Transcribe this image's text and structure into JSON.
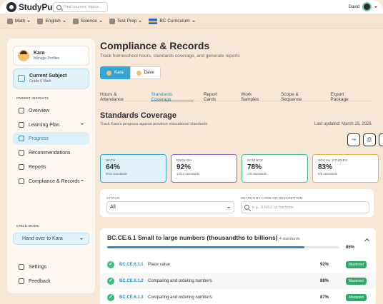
{
  "app": {
    "name": "StudyPug",
    "search_placeholder": "Find courses, topics...",
    "user_name": "David"
  },
  "nav": [
    {
      "label": "Math"
    },
    {
      "label": "English"
    },
    {
      "label": "Science"
    },
    {
      "label": "Test Prep"
    },
    {
      "label": "BC Curriculum"
    }
  ],
  "sidebar": {
    "profile": {
      "name": "Kara",
      "sub": "Manage Profiles"
    },
    "subject": {
      "title": "Current Subject",
      "sub": "Grade 6 Math"
    },
    "parent_insights_heading": "PARENT INSIGHTS",
    "items": [
      {
        "label": "Overview"
      },
      {
        "label": "Learning Plan"
      },
      {
        "label": "Progress"
      },
      {
        "label": "Recommendations"
      },
      {
        "label": "Reports"
      },
      {
        "label": "Compliance & Records"
      }
    ],
    "child_mode_heading": "CHILD MODE",
    "handover_label": "Hand over to Kara",
    "bottom": [
      {
        "label": "Settings"
      },
      {
        "label": "Feedback"
      }
    ]
  },
  "main": {
    "title": "Compliance & Records",
    "subtitle": "Track homeschool hours, standards coverage, and generate reports",
    "students": [
      "Kara",
      "Dave"
    ],
    "tabs": [
      "Hours & Attendance",
      "Standards Coverage",
      "Report Cards",
      "Work Samples",
      "Scope & Sequence",
      "Export Package"
    ],
    "section_title": "Standards Coverage",
    "section_sub": "Track Kara's progress against province educational standards",
    "last_updated": "Last updated: March 15, 2026",
    "cards": [
      {
        "label": "MATH",
        "value": "64%",
        "sub": "9/19 standards"
      },
      {
        "label": "ENGLISH",
        "value": "92%",
        "sub": "12/13 standards"
      },
      {
        "label": "SCIENCE",
        "value": "78%",
        "sub": "7/9 standards"
      },
      {
        "label": "SOCIAL STUDIES",
        "value": "83%",
        "sub": "5/6 standards"
      }
    ],
    "filters": {
      "status_label": "STATUS",
      "status_value": "All",
      "search_label": "SEARCH BY CODE OR DESCRIPTION",
      "search_placeholder": "e.g., 6.NS.1 or fractions"
    },
    "standard_group": {
      "title": "BC.CE.6.1 Small to large numbers (thousandths to billions)",
      "count": "4 standards",
      "progress_label": "85%",
      "progress": 0.85
    },
    "standards": [
      {
        "code": "BC.CE.6.1.1",
        "desc": "Place value",
        "pct": "92%",
        "status": "Mastered"
      },
      {
        "code": "BC.CE.6.1.2",
        "desc": "Comparing and ordering numbers",
        "pct": "88%",
        "status": "Mastered"
      },
      {
        "code": "BC.CE.6.1.3",
        "desc": "Comparing and ordering numbers",
        "pct": "87%",
        "status": "Mastered"
      }
    ],
    "colors": {
      "accent": "#2d8cbf",
      "mastered": "#2fa86a"
    }
  }
}
